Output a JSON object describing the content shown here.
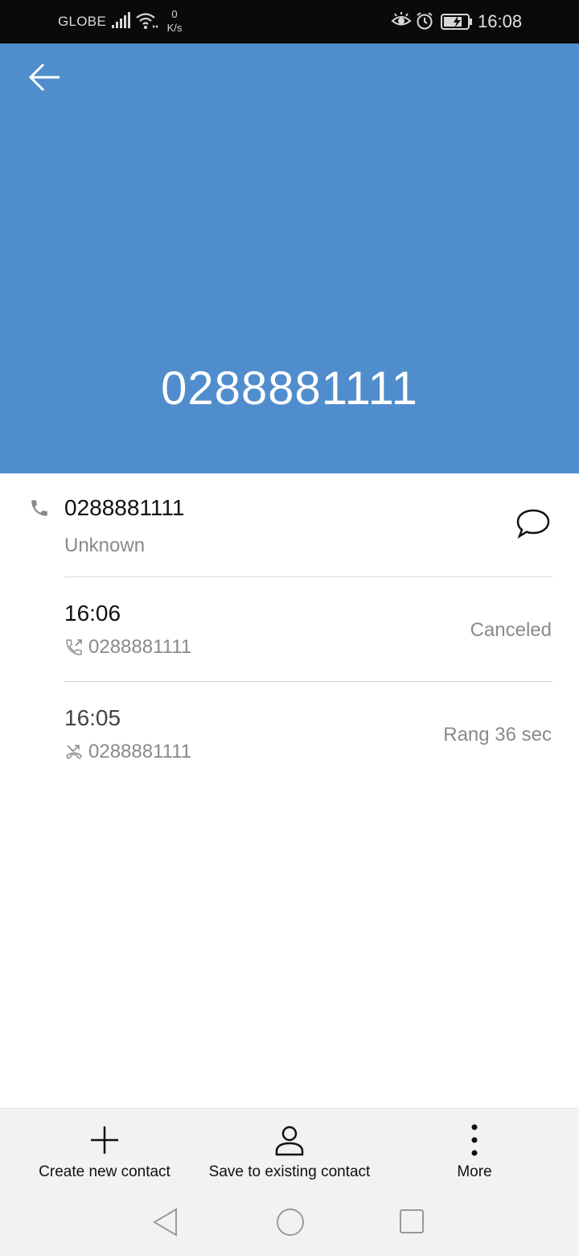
{
  "status_bar": {
    "carrier": "GLOBE",
    "speed_value": "0",
    "speed_unit": "K/s",
    "time": "16:08"
  },
  "header": {
    "number": "0288881111"
  },
  "contact": {
    "number": "0288881111",
    "label": "Unknown"
  },
  "calls": [
    {
      "time": "16:06",
      "number": "0288881111",
      "status": "Canceled",
      "direction": "outgoing"
    },
    {
      "time": "16:05",
      "number": "0288881111",
      "status": "Rang 36 sec",
      "direction": "missed"
    }
  ],
  "actions": {
    "create": "Create new contact",
    "save": "Save to existing contact",
    "more": "More"
  },
  "colors": {
    "header_bg": "#508dcc",
    "status_bar_bg": "#0a0a0a",
    "action_bar_bg": "#f2f2f2"
  }
}
